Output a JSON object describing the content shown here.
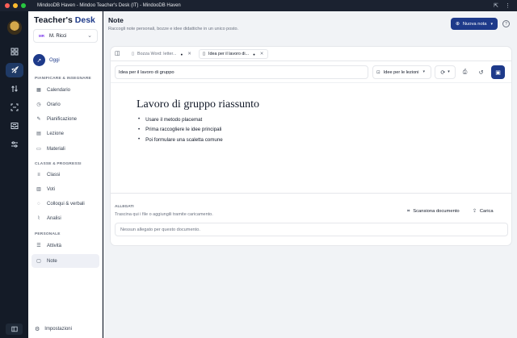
{
  "window": {
    "title": "MindooDB Haven - Mindoo Teacher's Desk (IT) - MindooDB Haven"
  },
  "colors": {
    "accent": "#1e3a8a",
    "rail": "#141b27",
    "background": "#f1f3f6"
  },
  "rail": {
    "icons": [
      "dashboard-icon",
      "rocket-icon",
      "transfer-icon",
      "scan-icon",
      "inbox-icon",
      "sliders-icon"
    ],
    "active_index": 1,
    "bottom_icon": "sidebar-toggle-icon"
  },
  "sidebar": {
    "brand_prefix": "Teacher's",
    "brand_highlight": "Desk",
    "user": {
      "initials": "MR",
      "name": "M. Ricci"
    },
    "today": {
      "label": "Oggi",
      "icon": "rocket-icon"
    },
    "sections": [
      {
        "title": "PIANIFICARE & INSEGNARE",
        "items": [
          {
            "label": "Calendario",
            "icon": "calendar-icon"
          },
          {
            "label": "Orario",
            "icon": "clock-icon"
          },
          {
            "label": "Pianificazione",
            "icon": "edit-icon"
          },
          {
            "label": "Lezione",
            "icon": "file-icon"
          },
          {
            "label": "Materiali",
            "icon": "folder-icon"
          }
        ]
      },
      {
        "title": "CLASSE & PROGRESSI",
        "items": [
          {
            "label": "Classi",
            "icon": "layers-icon"
          },
          {
            "label": "Voti",
            "icon": "bar-chart-icon"
          },
          {
            "label": "Colloqui & verbali",
            "icon": "chat-icon"
          },
          {
            "label": "Analisi",
            "icon": "analytics-icon"
          }
        ]
      },
      {
        "title": "PERSONALE",
        "items": [
          {
            "label": "Attività",
            "icon": "checklist-icon"
          },
          {
            "label": "Note",
            "icon": "note-icon"
          }
        ]
      }
    ],
    "active_item": "Note",
    "settings_label": "Impostazioni"
  },
  "main": {
    "title": "Note",
    "subtitle": "Raccogli note personali, bozze e idee didattiche in un unico posto.",
    "new_note_label": "Nuova nota",
    "help_label": "?",
    "tabs": [
      {
        "label": "Bozza Word: letter...",
        "active": false,
        "unsaved": true
      },
      {
        "label": "Idea per il lavoro di...",
        "active": true,
        "unsaved": true
      }
    ],
    "note_title_value": "Idea per il lavoro di gruppo",
    "category_value": "Idee per le lezioni",
    "document": {
      "heading": "Lavoro di gruppo riassunto",
      "bullets": [
        "Usare il metodo placemat",
        "Prima raccogliere le idee principali",
        "Poi formulare una scaletta comune"
      ]
    },
    "attachments": {
      "label": "ALLEGATI",
      "hint": "Trascina qui i file o aggiungili tramite caricamento.",
      "scan_label": "Scansiona documento",
      "upload_label": "Carica",
      "empty_text": "Nessun allegato per questo documento."
    }
  }
}
